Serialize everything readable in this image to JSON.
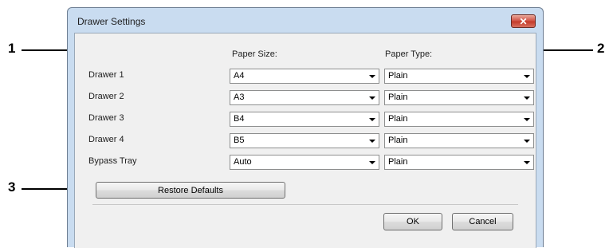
{
  "callouts": [
    "1",
    "2",
    "3"
  ],
  "dialog": {
    "title": "Drawer Settings",
    "close_symbol": "✕",
    "columns": {
      "paper_size": "Paper Size:",
      "paper_type": "Paper Type:"
    },
    "rows": [
      {
        "label": "Drawer 1",
        "size": "A4",
        "type": "Plain"
      },
      {
        "label": "Drawer 2",
        "size": "A3",
        "type": "Plain"
      },
      {
        "label": "Drawer 3",
        "size": "B4",
        "type": "Plain"
      },
      {
        "label": "Drawer 4",
        "size": "B5",
        "type": "Plain"
      },
      {
        "label": "Bypass Tray",
        "size": "Auto",
        "type": "Plain"
      }
    ],
    "restore_defaults": "Restore Defaults",
    "ok": "OK",
    "cancel": "Cancel"
  },
  "colors": {
    "close_button": "#c43b2b",
    "frame": "#c9dcf0",
    "client": "#f0f0f0"
  }
}
